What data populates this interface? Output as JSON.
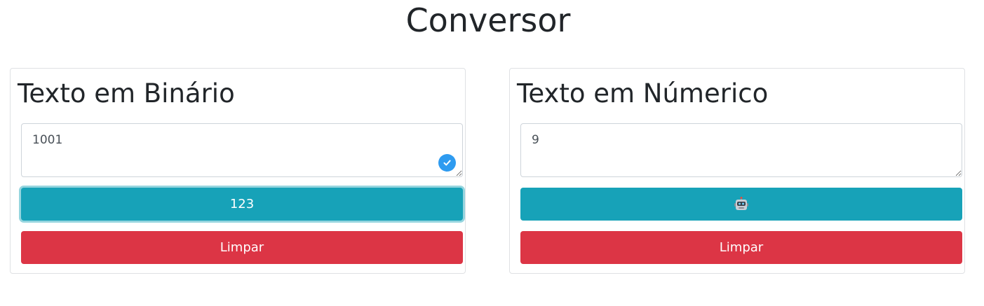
{
  "page": {
    "title": "Conversor"
  },
  "binary_card": {
    "title": "Texto em Binário",
    "input_value": "1001",
    "convert_label": "123",
    "clear_label": "Limpar"
  },
  "numeric_card": {
    "title": "Texto em Númerico",
    "input_value": "9",
    "convert_icon": "robot-icon",
    "clear_label": "Limpar"
  },
  "colors": {
    "info": "#17a2b8",
    "danger": "#dc3545",
    "check_badge": "#2e9bf0"
  }
}
